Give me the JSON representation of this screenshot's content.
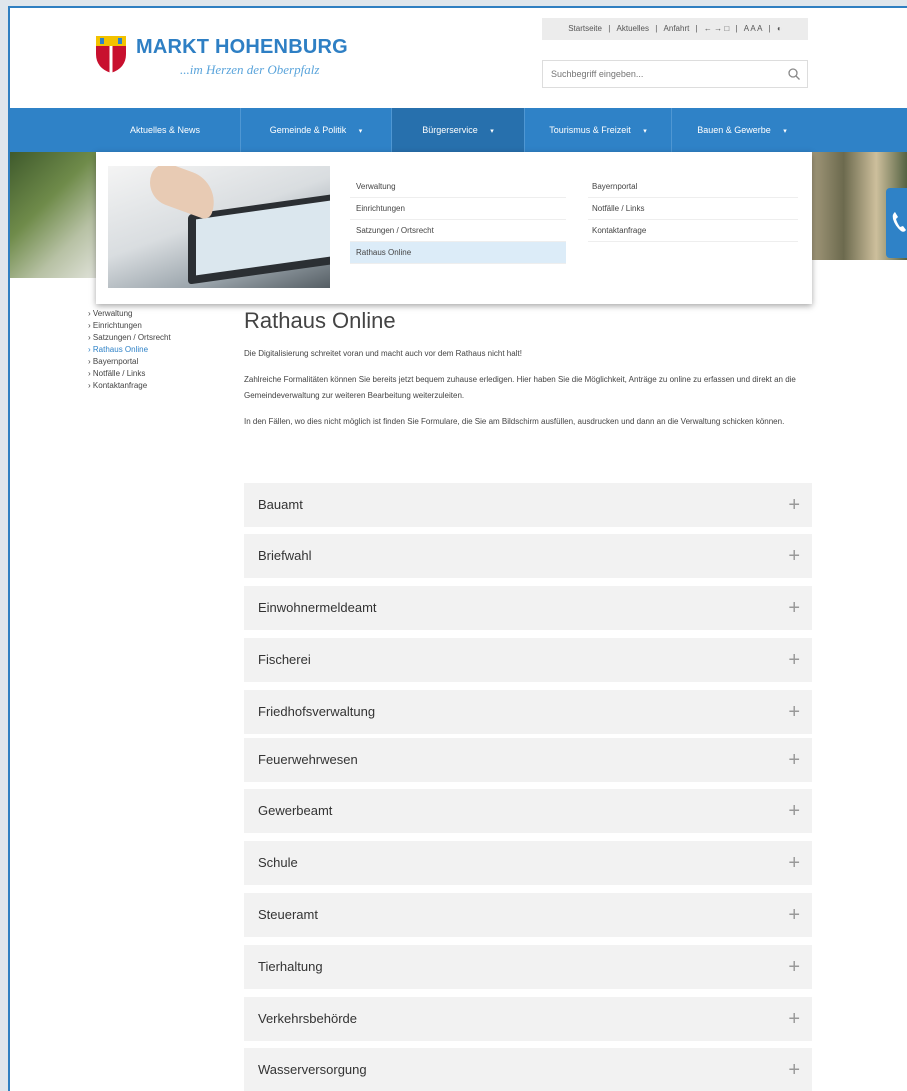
{
  "brand": {
    "name": "MARKT HOHENBURG",
    "tagline": "...im Herzen der Oberpfalz"
  },
  "utility_bar": {
    "items": [
      "Startseite",
      "|",
      "Aktuelles",
      "|",
      "Anfahrt",
      "|",
      "← → □",
      "|",
      "A A A",
      "|",
      "◐"
    ]
  },
  "search": {
    "placeholder": "Suchbegriff eingeben..."
  },
  "nav": {
    "items": [
      {
        "label": "Aktuelles & News"
      },
      {
        "label": "Gemeinde & Politik"
      },
      {
        "label": "Bürgerservice"
      },
      {
        "label": "Tourismus & Freizeit"
      },
      {
        "label": "Bauen & Gewerbe"
      }
    ],
    "caret": "▾"
  },
  "mega_menu": {
    "col1": [
      "Verwaltung",
      "Einrichtungen",
      "Satzungen / Ortsrecht",
      "Rathaus Online"
    ],
    "col2": [
      "Bayernportal",
      "Notfälle / Links",
      "Kontaktanfrage"
    ]
  },
  "sidebar": {
    "items": [
      "Verwaltung",
      "Einrichtungen",
      "Satzungen / Ortsrecht",
      "Rathaus Online",
      "Bayernportal",
      "Notfälle / Links",
      "Kontaktanfrage"
    ],
    "bullet": "›"
  },
  "main": {
    "title": "Rathaus Online",
    "paragraphs": [
      "Die Digitalisierung schreitet voran und macht auch vor dem Rathaus nicht halt!",
      "Zahlreiche Formalitäten können Sie bereits jetzt bequem zuhause erledigen. Hier haben Sie die Möglichkeit, Anträge zu online zu erfassen und direkt an die Gemeindeverwaltung zur weiteren Bearbeitung weiterzuleiten.",
      "In den Fällen, wo dies nicht möglich ist finden Sie Formulare, die Sie am Bildschirm ausfüllen, ausdrucken und dann an die Verwaltung schicken können."
    ],
    "accordion": [
      {
        "label": "Bauamt"
      },
      {
        "label": "Briefwahl"
      },
      {
        "label": "Einwohnermeldeamt"
      },
      {
        "label": "Fischerei"
      },
      {
        "label": "Friedhofsverwaltung"
      },
      {
        "label": "Feuerwehrwesen"
      },
      {
        "label": "Gewerbeamt"
      },
      {
        "label": "Schule"
      },
      {
        "label": "Steueramt"
      },
      {
        "label": "Tierhaltung"
      },
      {
        "label": "Verkehrsbehörde"
      },
      {
        "label": "Wasserversorgung"
      }
    ],
    "expand_symbol": "+"
  },
  "colors": {
    "brand_blue": "#2f82c7",
    "nav_active": "#2770ad",
    "accordion_bg": "#f2f2f2"
  }
}
